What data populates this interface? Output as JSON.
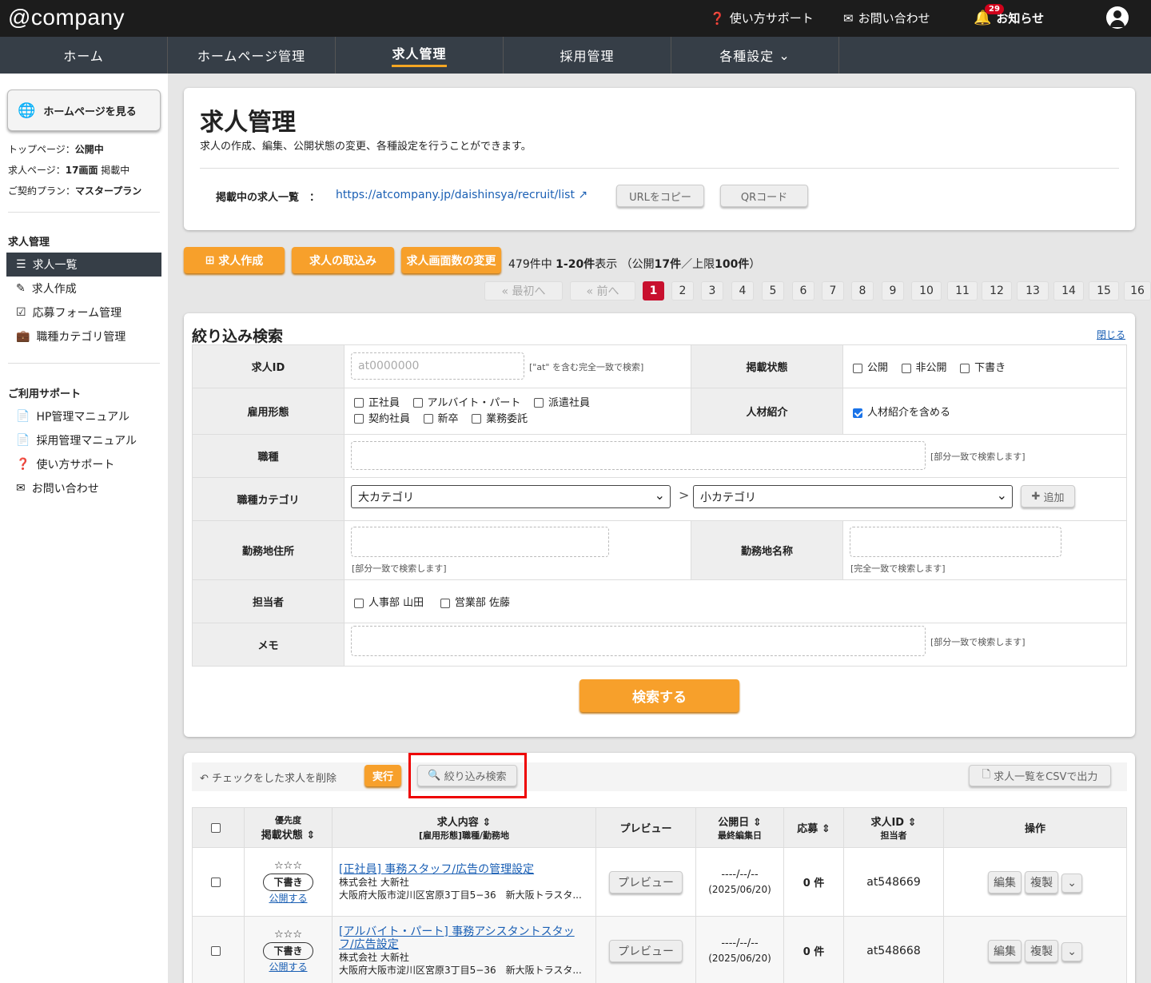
{
  "header": {
    "logo": "@company",
    "support": "使い方サポート",
    "contact": "お問い合わせ",
    "notice": "お知らせ",
    "notice_count": "29"
  },
  "nav": {
    "items": [
      "ホーム",
      "ホームページ管理",
      "求人管理",
      "採用管理",
      "各種設定"
    ]
  },
  "sidebar": {
    "view_hp": "ホームページを見る",
    "info": [
      {
        "label": "トップページ：",
        "value": "公開中",
        "suffix": ""
      },
      {
        "label": "求人ページ：",
        "value": "17画面",
        "suffix": " 掲載中"
      },
      {
        "label": "ご契約プラン：",
        "value": "マスタープラン",
        "suffix": ""
      }
    ],
    "section1": "求人管理",
    "items1": [
      "求人一覧",
      "求人作成",
      "応募フォーム管理",
      "職種カテゴリ管理"
    ],
    "section2": "ご利用サポート",
    "items2": [
      "HP管理マニュアル",
      "採用管理マニュアル",
      "使い方サポート",
      "お問い合わせ"
    ]
  },
  "page": {
    "title": "求人管理",
    "desc": "求人の作成、編集、公開状態の変更、各種設定を行うことができます。",
    "list_label": "掲載中の求人一覧　：",
    "list_url": "https://atcompany.jp/daishinsya/recruit/list",
    "copy_url": "URLをコピー",
    "qr": "QRコード"
  },
  "actions": {
    "create": "求人作成",
    "import": "求人の取込み",
    "change": "求人画面数の変更",
    "count_total": "479件中 ",
    "count_range": "1-20件",
    "count_mid": "表示 （公開",
    "count_pub": "17件",
    "count_lim": "／上限",
    "count_max": "100件",
    "count_end": "）"
  },
  "pagination": {
    "first": "« 最初へ",
    "prev": "« 前へ",
    "pages": [
      "1",
      "2",
      "3",
      "4",
      "5",
      "6",
      "7",
      "8",
      "9",
      "10",
      "11",
      "12",
      "13",
      "14",
      "15",
      "16"
    ]
  },
  "filter": {
    "title": "絞り込み検索",
    "close": "閉じる",
    "id_label": "求人ID",
    "id_placeholder": "at0000000",
    "id_note": "[\"at\" を含む完全一致で検索]",
    "status_label": "掲載状態",
    "status_opts": [
      "公開",
      "非公開",
      "下書き"
    ],
    "emp_label": "雇用形態",
    "emp_opts1": [
      "正社員",
      "アルバイト・パート",
      "派遣社員"
    ],
    "emp_opts2": [
      "契約社員",
      "新卒",
      "業務委託"
    ],
    "agent_label": "人材紹介",
    "agent_opt": "人材紹介を含める",
    "job_label": "職種",
    "partial_note": "[部分一致で検索します]",
    "cat_label": "職種カテゴリ",
    "cat_big": "大カテゴリ",
    "cat_small": "小カテゴリ",
    "add": "追加",
    "addr_label": "勤務地住所",
    "place_label": "勤務地名称",
    "exact_note": "[完全一致で検索します]",
    "staff_label": "担当者",
    "staff_opts": [
      "人事部 山田",
      "営業部 佐藤"
    ],
    "memo_label": "メモ",
    "search_btn": "検索する"
  },
  "list": {
    "delete_label": "チェックをした求人を削除",
    "exec": "実行",
    "filter_btn": "絞り込み検索",
    "csv": "求人一覧をCSVで出力",
    "headers": {
      "priority": "優先度",
      "status": "掲載状態",
      "content": "求人内容",
      "content_sub": "[雇用形態]職種/勤務地",
      "preview": "プレビュー",
      "date": "公開日",
      "date_sub": "最終編集日",
      "apply": "応募",
      "id": "求人ID",
      "staff": "担当者",
      "ops": "操作"
    },
    "rows": [
      {
        "stars": "☆☆☆",
        "status": "下書き",
        "publish": "公開する",
        "title": "[正社員] 事務スタッフ/広告の管理設定",
        "company": "株式会社 大新社",
        "addr": "大阪府大阪市淀川区宮原3丁目5−36　新大阪トラスタ...",
        "preview": "プレビュー",
        "date": "----/--/--",
        "edited": "(2025/06/20)",
        "apply": "0 件",
        "id": "at548669",
        "edit": "編集",
        "copy": "複製"
      },
      {
        "stars": "☆☆☆",
        "status": "下書き",
        "publish": "公開する",
        "title": "[アルバイト・パート] 事務アシスタントスタッフ/広告設定",
        "company": "株式会社 大新社",
        "addr": "大阪府大阪市淀川区宮原3丁目5−36　新大阪トラスタ...",
        "preview": "プレビュー",
        "date": "----/--/--",
        "edited": "(2025/06/20)",
        "apply": "0 件",
        "id": "at548668",
        "edit": "編集",
        "copy": "複製"
      }
    ]
  }
}
